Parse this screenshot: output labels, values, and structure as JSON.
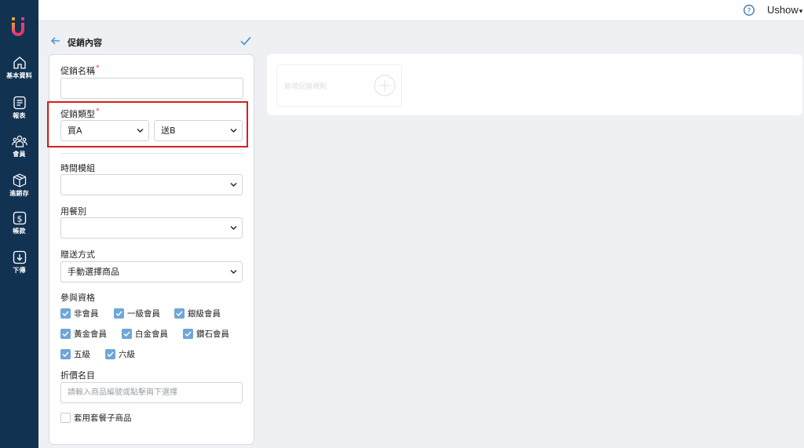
{
  "nav": [
    {
      "label": "基本資料",
      "icon": "home-icon"
    },
    {
      "label": "報表",
      "icon": "report-icon"
    },
    {
      "label": "會員",
      "icon": "members-icon"
    },
    {
      "label": "進銷存",
      "icon": "inventory-box-icon"
    },
    {
      "label": "帳款",
      "icon": "dollar-icon"
    },
    {
      "label": "下傳",
      "icon": "download-icon"
    }
  ],
  "topbar": {
    "user": "Ushow",
    "caret": "▾"
  },
  "header": {
    "title": "促銷內容"
  },
  "form": {
    "name_label": "促銷名稱",
    "required_mark": "*",
    "name_value": "",
    "type_label": "促銷類型",
    "type_buy": "買A",
    "type_give": "送B",
    "time_label": "時間模組",
    "time_value": "",
    "meal_label": "用餐別",
    "meal_value": "",
    "gift_label": "贈送方式",
    "gift_value": "手動選擇商品",
    "qual_label": "參與資格",
    "qualifications": [
      {
        "label": "非會員",
        "checked": true
      },
      {
        "label": "一級會員",
        "checked": true
      },
      {
        "label": "銀級會員",
        "checked": true
      },
      {
        "label": "黃金會員",
        "checked": true
      },
      {
        "label": "白金會員",
        "checked": true
      },
      {
        "label": "鑽石會員",
        "checked": true
      },
      {
        "label": "五級",
        "checked": true
      },
      {
        "label": "六級",
        "checked": true
      }
    ],
    "discount_label": "折價名目",
    "discount_placeholder": "請輸入商品編號或點擊兩下選擇",
    "combo_label": "套用套餐子商品",
    "combo_checked": false
  },
  "rules": {
    "new_rule_label": "新增促銷規則"
  },
  "colors": {
    "sidebar": "#123252",
    "accent": "#6ea6d8",
    "highlight": "#d71f1f"
  }
}
